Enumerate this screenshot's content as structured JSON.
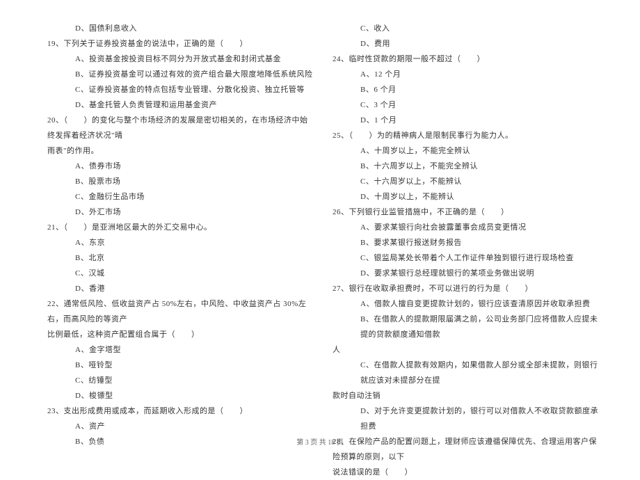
{
  "left": {
    "l0": "D、国债利息收入",
    "q19": "19、下列关于证券投资基金的说法中，正确的是（　　）",
    "q19a": "A、投资基金按投资目标不同分为开放式基金和封闭式基金",
    "q19b": "B、证券投资基金可以通过有效的资产组合最大限度地降低系统风险",
    "q19c": "C、证券投资基金的特点包括专业管理、分散化投资、独立托管等",
    "q19d": "D、基金托管人负责管理和运用基金资产",
    "q20a_line1": "20、（　　）的变化与整个市场经济的发展是密切相关的，在市场经济中始终发挥着经济状况\"晴",
    "q20a_line2": "雨表\"的作用。",
    "q20_a": "A、债券市场",
    "q20_b": "B、股票市场",
    "q20_c": "C、金融衍生品市场",
    "q20_d": "D、外汇市场",
    "q21": "21、（　　）是亚洲地区最大的外汇交易中心。",
    "q21a": "A、东京",
    "q21b": "B、北京",
    "q21c": "C、汉城",
    "q21d": "D、香港",
    "q22_line1": "22、通常低风险、低收益资产占 50%左右，中风险、中收益资产占 30%左右，而高风险的等资产",
    "q22_line2": "比例最低，这种资产配置组合属于（　　）",
    "q22a": "A、金字塔型",
    "q22b": "B、哑铃型",
    "q22c": "C、纺锤型",
    "q22d": "D、梭镖型",
    "q23": "23、支出形成费用或成本，而延期收入形成的是（　　）",
    "q23a": "A、资产",
    "q23b": "B、负债"
  },
  "right": {
    "q23c": "C、收入",
    "q23d": "D、费用",
    "q24": "24、临时性贷款的期限一般不超过（　　）",
    "q24a": "A、12 个月",
    "q24b": "B、6 个月",
    "q24c": "C、3 个月",
    "q24d": "D、1 个月",
    "q25": "25、（　　）为的精神病人是限制民事行为能力人。",
    "q25a": "A、十周岁以上，不能完全辨认",
    "q25b": "B、十六周岁以上，不能完全辨认",
    "q25c": "C、十六周岁以上，不能辨认",
    "q25d": "D、十周岁以上，不能辨认",
    "q26": "26、下列银行业监管措施中，不正确的是（　　）",
    "q26a": "A、要求某银行向社会披露董事会成员变更情况",
    "q26b": "B、要求某银行报送财务报告",
    "q26c": "C、银监局某处长带着个人工作证件单独到银行进行现场检查",
    "q26d": "D、要求某银行总经理就银行的某项业务做出说明",
    "q27": "27、银行在收取承担费时，不可以进行的行为是（　　）",
    "q27a": "A、借款人擅自变更提款计划的，银行应该查清原因并收取承担费",
    "q27b_line1": "B、在借款人的提款期限届满之前，公司业务部门应将借款人应提未提的贷款额度通知借款",
    "q27b_line2": "人",
    "q27c_line1": "C、在借款人提款有效期内，如果借款人部分或全部未提款，则银行就应该对未提部分在提",
    "q27c_line2": "款时自动注销",
    "q27d": "D、对于允许变更提款计划的，银行可以对借款人不收取贷款额度承担费",
    "q28_line1": "28、在保险产品的配置问题上，理财师应该遵循保障优先、合理运用客户保险预算的原则，以下",
    "q28_line2": "说法错误的是（　　）"
  },
  "footer": "第 3 页 共 18 页"
}
